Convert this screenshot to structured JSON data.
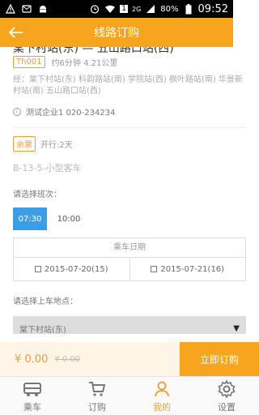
{
  "status_bar": {
    "battery": "80%",
    "time": "09:52",
    "sim": "1",
    "network": "2G"
  },
  "header": {
    "title": "线路订购"
  },
  "route": {
    "name": "棠下村站(东) — 五山路口站(西)",
    "line_tag": "Th001",
    "meta": "约6分钟 4.21公里",
    "stops": "经：棠下村站(东) 科韵路站(南) 学院站(西) 枫叶路站(南) 华景新村站(南) 五山路口站(西)",
    "company": "测试企业1 020-234234"
  },
  "ticket": {
    "badge": "余票",
    "run_days": "开行:2天",
    "vehicle": "B-13-5-小型客车"
  },
  "schedule": {
    "label": "请选择班次：",
    "times": [
      "07:30",
      "10:00"
    ],
    "selected": "07:30"
  },
  "dates": {
    "header": "乘车日期",
    "options": [
      "2015-07-20(15)",
      "2015-07-21(16)"
    ]
  },
  "boarding": {
    "label": "请选择上车地点：",
    "selected": "棠下村站(东)"
  },
  "order": {
    "price": "¥ 0.00",
    "original_price": "¥ 0.00",
    "button": "立即订购"
  },
  "tabs": [
    {
      "label": "乘车",
      "icon": "bus-icon"
    },
    {
      "label": "订购",
      "icon": "cart-icon"
    },
    {
      "label": "我的",
      "icon": "person-icon"
    },
    {
      "label": "设置",
      "icon": "gear-icon"
    }
  ],
  "colors": {
    "accent": "#f7a51e",
    "selected_time": "#3a9fe8"
  }
}
